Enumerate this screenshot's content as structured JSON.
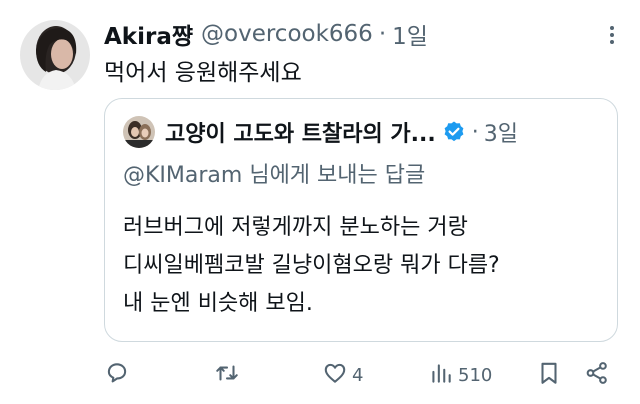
{
  "tweet": {
    "display_name": "Akira쨩",
    "handle": "@overcook666",
    "separator": "·",
    "time": "1일",
    "text": "먹어서 응원해주세요"
  },
  "quote": {
    "display_name": "고양이 고도와 트찰라의 가...",
    "separator": "·",
    "time": "3일",
    "reply_to": "@KIMaram 님에게 보내는 답글",
    "lines": [
      "러브버그에 저렇게까지 분노하는 거랑",
      "디씨일베펨코발 길냥이혐오랑 뭐가 다름?",
      "내 눈엔 비슷해 보임."
    ]
  },
  "actions": {
    "likes": "4",
    "views": "510"
  },
  "icons": {
    "more": "more-dots-icon",
    "reply": "reply-icon",
    "retweet": "retweet-icon",
    "like": "heart-icon",
    "views": "views-icon",
    "bookmark": "bookmark-icon",
    "share": "share-icon",
    "verified": "verified-badge-icon"
  },
  "colors": {
    "text": "#0f1419",
    "secondary": "#536471",
    "border": "#cfd9de",
    "verified": "#1d9bf0"
  }
}
